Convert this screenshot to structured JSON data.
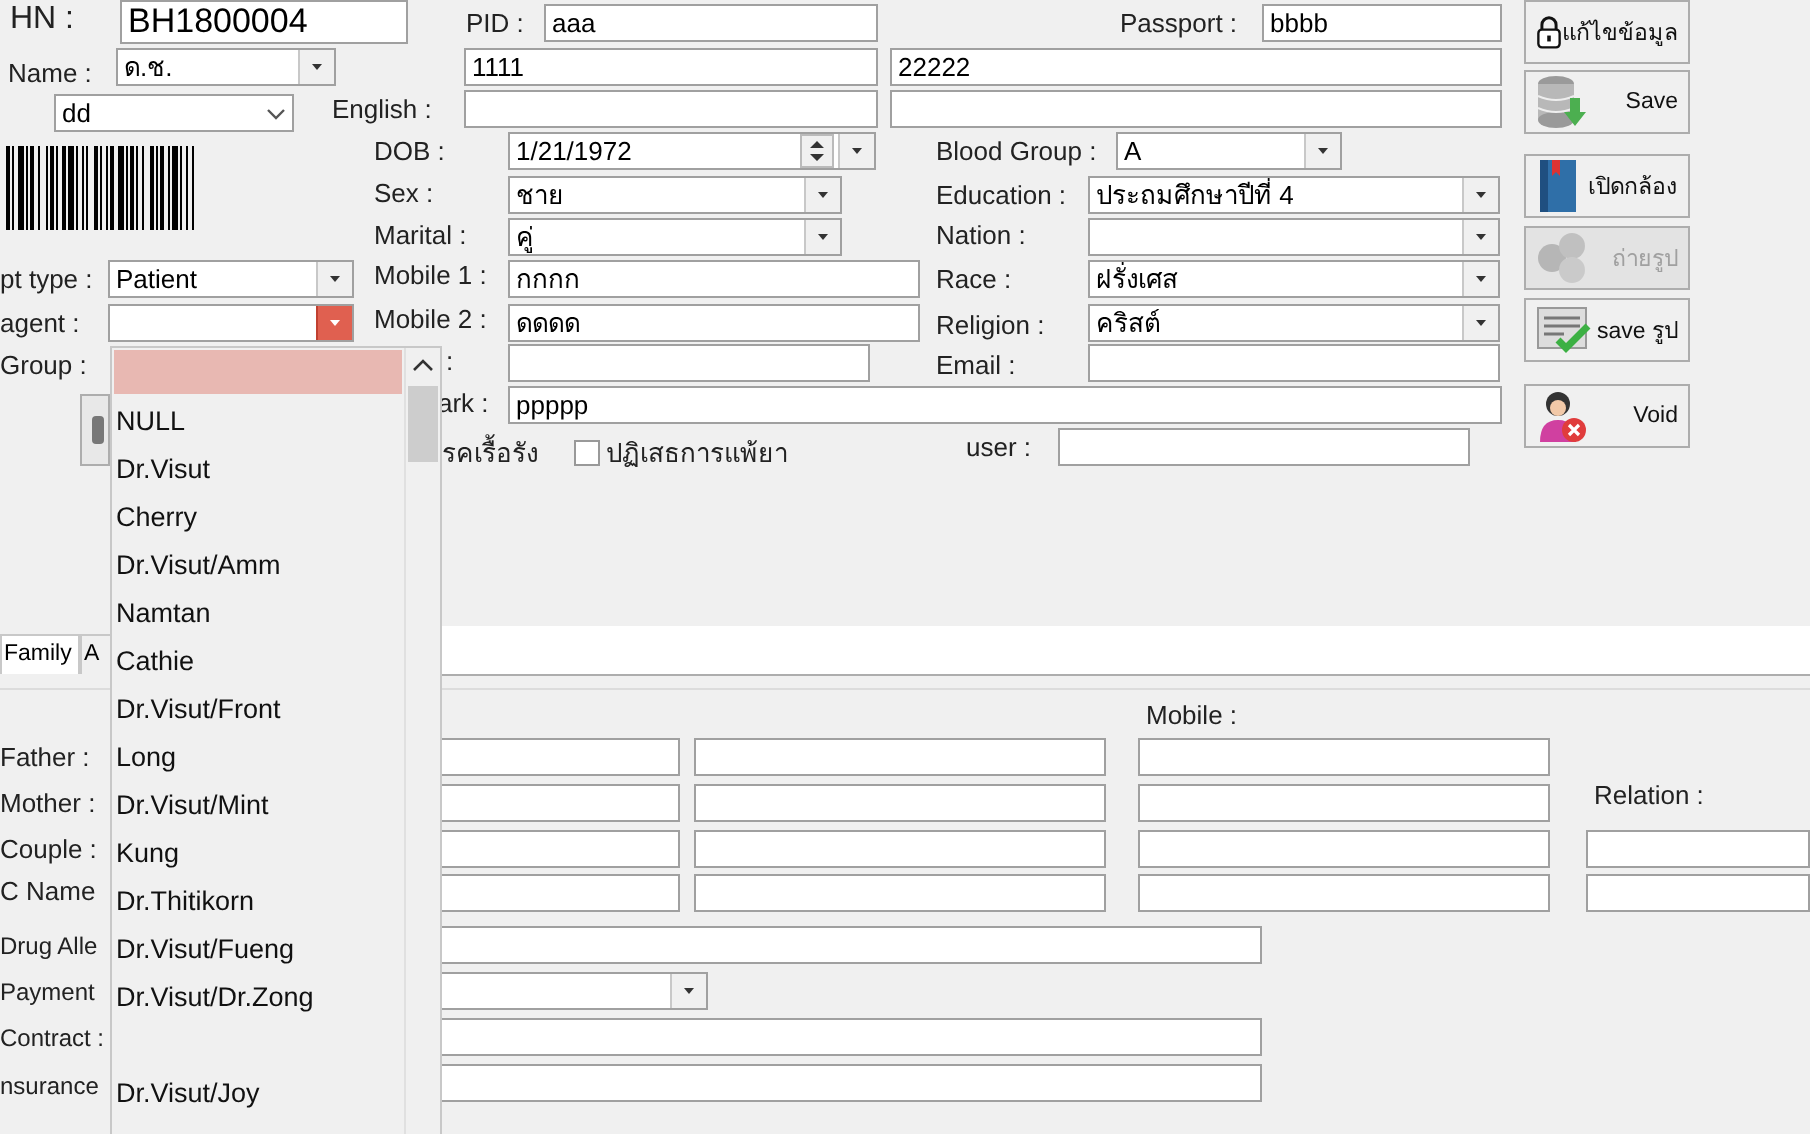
{
  "labels": [
    "HN :",
    "PID :",
    "Passport :",
    "Name :",
    "English :",
    "DOB :",
    "Blood Group :",
    "Sex :",
    "Education :",
    "Marital :",
    "Nation :",
    "pt type :",
    "Mobile 1 :",
    "Race :",
    "agent :",
    "Mobile 2 :",
    "Religion :",
    "Group :",
    ":",
    "Email :",
    "ark :",
    "รคเรื้อรัง",
    "user :",
    "Mobile :",
    "Father :",
    "Relation :",
    "Mother :",
    "Couple :",
    "C Name",
    "Drug Alle",
    "Payment",
    "Contract :",
    "nsurance"
  ],
  "inputs": [
    {
      "kind": "text",
      "value": "BH1800004"
    },
    {
      "kind": "text",
      "value": "aaa"
    },
    {
      "kind": "text",
      "value": "bbbb"
    },
    {
      "kind": "combo",
      "value": "ด.ช.",
      "open": false
    },
    {
      "kind": "text",
      "value": "1111"
    },
    {
      "kind": "text",
      "value": "22222"
    },
    {
      "kind": "select",
      "value": "dd"
    },
    {
      "kind": "text"
    },
    {
      "kind": "text"
    },
    {
      "kind": "date",
      "value": "1/21/1972"
    },
    {
      "kind": "combo",
      "value": "A",
      "open": false
    },
    {
      "kind": "combo",
      "value": "ชาย",
      "open": false
    },
    {
      "kind": "combo",
      "value": "ประถมศึกษาปีที่ 4",
      "open": false
    },
    {
      "kind": "combo",
      "value": "คู่",
      "open": false
    },
    {
      "kind": "combo",
      "open": false
    },
    {
      "kind": "combo",
      "value": "Patient",
      "open": false
    },
    {
      "kind": "text",
      "value": "กกกก"
    },
    {
      "kind": "combo",
      "value": "ฝรั่งเศส",
      "open": false
    },
    {
      "kind": "combo",
      "open": true
    },
    {
      "kind": "text",
      "value": "ดดดด"
    },
    {
      "kind": "combo",
      "value": "คริสต์",
      "open": false
    },
    {
      "kind": "text"
    },
    {
      "kind": "text"
    },
    {
      "kind": "text",
      "value": "ppppp"
    },
    {
      "kind": "text"
    },
    {
      "kind": "text"
    },
    {
      "kind": "text"
    },
    {
      "kind": "text"
    },
    {
      "kind": "text"
    },
    {
      "kind": "text"
    },
    {
      "kind": "text"
    },
    {
      "kind": "text"
    },
    {
      "kind": "text"
    },
    {
      "kind": "text"
    },
    {
      "kind": "text"
    },
    {
      "kind": "text"
    },
    {
      "kind": "text"
    },
    {
      "kind": "text"
    },
    {
      "kind": "text"
    },
    {
      "kind": "text"
    },
    {
      "kind": "combo",
      "open": false
    },
    {
      "kind": "text"
    },
    {
      "kind": "text"
    }
  ],
  "checkbox": {
    "label": "ปฏิเสธการแพ้ยา",
    "checked": false
  },
  "buttons": [
    {
      "label": "แก้ไขข้อมูล",
      "disabled": false
    },
    {
      "label": "Save",
      "disabled": false
    },
    {
      "label": "เปิดกล้อง",
      "disabled": false
    },
    {
      "label": "ถ่ายรูป",
      "disabled": true
    },
    {
      "label": "save รูป",
      "disabled": false
    },
    {
      "label": "Void",
      "disabled": false
    }
  ],
  "tabs": [
    {
      "label": "Family",
      "selected": true
    },
    {
      "label": "A",
      "selected": false
    }
  ],
  "dropdown": {
    "items": [
      {
        "selected": true
      },
      {
        "label": "NULL",
        "selected": false
      },
      {
        "label": "Dr.Visut",
        "selected": false
      },
      {
        "label": "Cherry",
        "selected": false
      },
      {
        "label": "Dr.Visut/Amm",
        "selected": false
      },
      {
        "label": "Namtan",
        "selected": false
      },
      {
        "label": "Cathie",
        "selected": false
      },
      {
        "label": "Dr.Visut/Front",
        "selected": false
      },
      {
        "label": "Long",
        "selected": false
      },
      {
        "label": "Dr.Visut/Mint",
        "selected": false
      },
      {
        "label": "Kung",
        "selected": false
      },
      {
        "label": "Dr.Thitikorn",
        "selected": false
      },
      {
        "label": "Dr.Visut/Fueng",
        "selected": false
      },
      {
        "label": "Dr.Visut/Dr.Zong",
        "selected": false
      },
      {
        "selected": false
      },
      {
        "label": "Dr.Visut/Joy",
        "selected": false
      }
    ]
  }
}
